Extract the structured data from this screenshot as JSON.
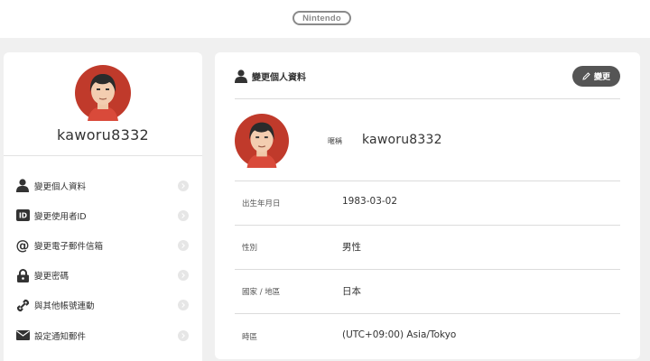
{
  "header": {
    "logo_text": "Nintendo"
  },
  "sidebar": {
    "username": "kaworu8332",
    "items": [
      {
        "label": "變更個人資料",
        "icon": "person-icon"
      },
      {
        "label": "變更使用者ID",
        "icon": "id-badge-icon"
      },
      {
        "label": "變更電子郵件信箱",
        "icon": "at-sign-icon"
      },
      {
        "label": "變更密碼",
        "icon": "lock-icon"
      },
      {
        "label": "與其他帳號連動",
        "icon": "link-icon"
      },
      {
        "label": "設定通知郵件",
        "icon": "envelope-icon"
      }
    ]
  },
  "profile": {
    "title": "變更個人資料",
    "edit_label": "變更",
    "nickname_label": "暱稱",
    "nickname": "kaworu8332",
    "fields": [
      {
        "label": "出生年月日",
        "value": "1983-03-02"
      },
      {
        "label": "性別",
        "value": "男性"
      },
      {
        "label": "國家 / 地區",
        "value": "日本"
      },
      {
        "label": "時區",
        "value": "(UTC+09:00) Asia/Tokyo"
      }
    ]
  }
}
